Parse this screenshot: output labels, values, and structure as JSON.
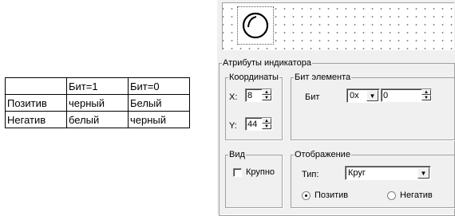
{
  "table": {
    "header": [
      "",
      "Бит=1",
      "Бит=0"
    ],
    "rows": [
      [
        "Позитив",
        "черный",
        "Белый"
      ],
      [
        "Негатив",
        "белый",
        "черный"
      ]
    ]
  },
  "dialog": {
    "attributes_title": "Атрибуты индикатора",
    "coordinates": {
      "title": "Координаты",
      "x_label": "X:",
      "x_value": "8",
      "y_label": "Y:",
      "y_value": "44"
    },
    "bit_element": {
      "title": "Бит элемента",
      "bit_label": "Бит",
      "prefix_value": "0x",
      "bit_value": "0"
    },
    "view": {
      "title": "Вид",
      "large_label": "Крупно",
      "large_checked": false
    },
    "display": {
      "title": "Отображение",
      "type_label": "Тип:",
      "type_value": "Круг",
      "positive_label": "Позитив",
      "negative_label": "Негатив",
      "selected": "positive"
    }
  },
  "icons": {
    "lamp": "circle-indicator-icon",
    "spin_up": "spin-up-arrow-icon",
    "spin_down": "spin-down-arrow-icon",
    "dropdown": "dropdown-arrow-icon"
  },
  "colors": {
    "dialog_bg": "#f0f0f0",
    "canvas_bg": "#ffffff",
    "grid_dots": "#8a8a8a"
  }
}
